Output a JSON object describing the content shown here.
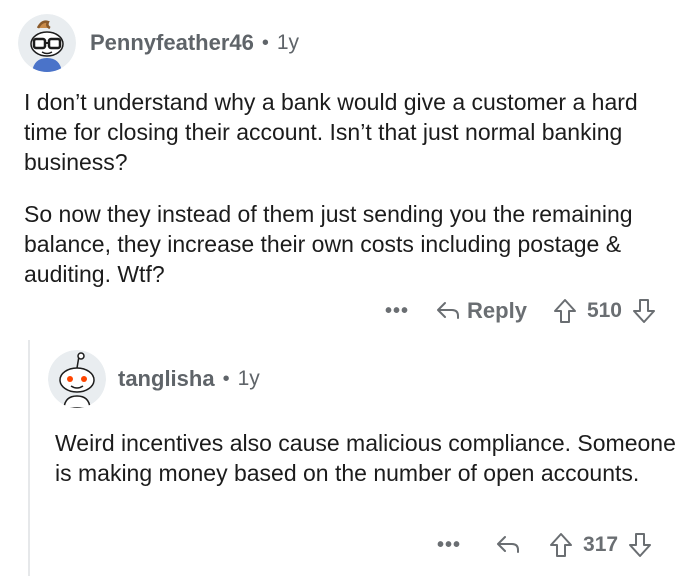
{
  "comments": [
    {
      "username": "Pennyfeather46",
      "separator": "•",
      "age": "1y",
      "avatar_icon": "snoo-glasses-avatar-icon",
      "paragraphs": [
        "I don’t understand why a bank would give a customer a hard time for closing their account. Isn’t that just normal banking business?",
        "So now they instead of them just sending you the remaining balance, they increase their own costs including postage & auditing. Wtf?"
      ],
      "actions": {
        "more_label": "•••",
        "reply_label": "Reply",
        "score": "510",
        "upvote_icon": "upvote-arrow-icon",
        "downvote_icon": "downvote-arrow-icon",
        "reply_icon": "reply-arrow-icon"
      }
    },
    {
      "username": "tanglisha",
      "separator": "•",
      "age": "1y",
      "avatar_icon": "snoo-default-avatar-icon",
      "paragraphs": [
        "Weird incentives also cause malicious compliance. Someone is making money based on the number of open accounts."
      ],
      "actions": {
        "more_label": "•••",
        "score": "317",
        "upvote_icon": "upvote-arrow-icon",
        "downvote_icon": "downvote-arrow-icon",
        "reply_icon": "reply-arrow-icon"
      }
    }
  ],
  "colors": {
    "text": "#1c1c1c",
    "meta": "#5f6469",
    "actions": "#6a6e72",
    "thread_line": "#e6e8ea",
    "avatar1_bg": "#e9edf0",
    "avatar2_bg": "#e9edf0",
    "snoo_red": "#ff4500"
  }
}
